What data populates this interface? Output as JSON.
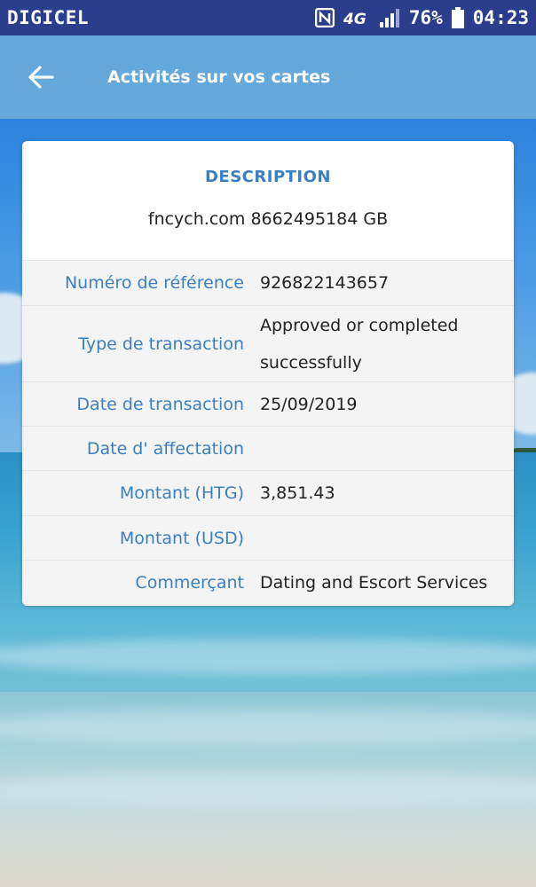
{
  "status_bar": {
    "carrier": "DIGICEL",
    "battery": "76%",
    "time": "04:23",
    "icons": [
      "nfc-icon",
      "4g-icon",
      "signal-icon",
      "battery-icon"
    ]
  },
  "app_bar": {
    "title": "Activités sur vos cartes",
    "back_icon": "arrow-left-icon"
  },
  "card": {
    "title": "DESCRIPTION",
    "description": "fncych.com 8662495184 GB",
    "rows": [
      {
        "label": "Numéro de référence",
        "value": "926822143657"
      },
      {
        "label": "Type de transaction",
        "value": "Approved or completed successfully"
      },
      {
        "label": "Date de transaction",
        "value": "25/09/2019"
      },
      {
        "label": "Date d' affectation",
        "value": ""
      },
      {
        "label": "Montant (HTG)",
        "value": "3,851.43"
      },
      {
        "label": "Montant (USD)",
        "value": ""
      },
      {
        "label": "Commerçant",
        "value": "Dating and Escort Services"
      }
    ]
  },
  "colors": {
    "status_bar_bg": "#2b3e8e",
    "app_bar_bg": "#64a8dc",
    "accent_text": "#3b7fbf"
  }
}
